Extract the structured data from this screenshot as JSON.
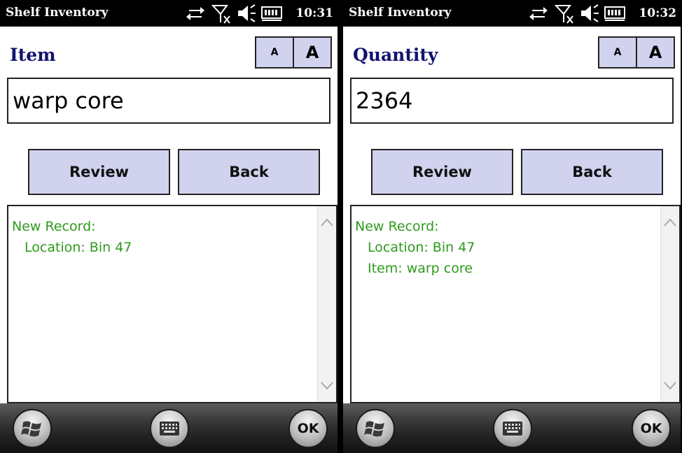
{
  "screens": [
    {
      "app_title": "Shelf Inventory",
      "time": "10:31",
      "field_label": "Item",
      "font_small_label": "A",
      "font_large_label": "A",
      "input_value": "warp core",
      "review_label": "Review",
      "back_label": "Back",
      "log_header": "New Record:",
      "log_lines": [
        "Location: Bin 47",
        ""
      ],
      "ok_label": "OK"
    },
    {
      "app_title": "Shelf Inventory",
      "time": "10:32",
      "field_label": "Quantity",
      "font_small_label": "A",
      "font_large_label": "A",
      "input_value": "2364",
      "review_label": "Review",
      "back_label": "Back",
      "log_header": "New Record:",
      "log_lines": [
        "Location: Bin 47",
        "Item: warp core"
      ],
      "ok_label": "OK"
    }
  ],
  "icons": {
    "status": [
      "sync-arrows-icon",
      "no-signal-icon",
      "speaker-icon",
      "battery-icon"
    ],
    "taskbar": [
      "windows-start-icon",
      "keyboard-icon",
      "ok-icon"
    ]
  },
  "colors": {
    "label": "#12126e",
    "button_fill": "#d0d2ee",
    "log_text": "#2e9a1c"
  }
}
